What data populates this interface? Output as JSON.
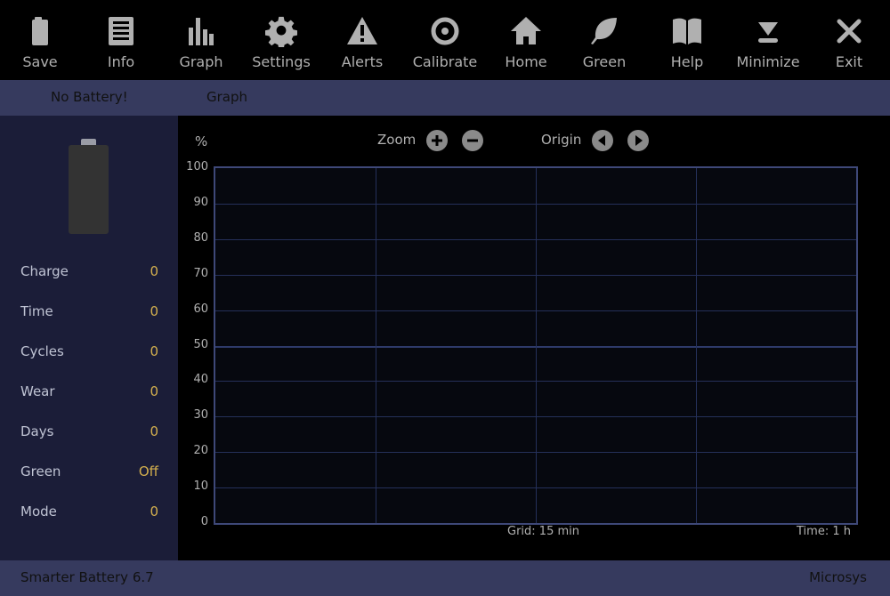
{
  "toolbar": {
    "items": [
      {
        "label": "Save",
        "icon": "battery-icon"
      },
      {
        "label": "Info",
        "icon": "document-icon"
      },
      {
        "label": "Graph",
        "icon": "bar-chart-icon"
      },
      {
        "label": "Settings",
        "icon": "gear-icon"
      },
      {
        "label": "Alerts",
        "icon": "warning-icon"
      },
      {
        "label": "Calibrate",
        "icon": "target-icon"
      },
      {
        "label": "Home",
        "icon": "home-icon"
      },
      {
        "label": "Green",
        "icon": "leaf-icon"
      },
      {
        "label": "Help",
        "icon": "book-icon"
      },
      {
        "label": "Minimize",
        "icon": "minimize-icon"
      },
      {
        "label": "Exit",
        "icon": "close-icon"
      }
    ]
  },
  "tabs": {
    "status": "No Battery!",
    "view": "Graph"
  },
  "battery": {
    "level": 0
  },
  "stats": [
    {
      "label": "Charge",
      "value": "0"
    },
    {
      "label": "Time",
      "value": "0"
    },
    {
      "label": "Cycles",
      "value": "0"
    },
    {
      "label": "Wear",
      "value": "0"
    },
    {
      "label": "Days",
      "value": "0"
    },
    {
      "label": "Green",
      "value": "Off"
    },
    {
      "label": "Mode",
      "value": "0"
    }
  ],
  "graph": {
    "unit_label": "%",
    "zoom_label": "Zoom",
    "origin_label": "Origin",
    "grid_label": "Grid: 15 min",
    "time_label": "Time: 1 h"
  },
  "chart_data": {
    "type": "line",
    "title": "",
    "xlabel": "Time: 1 h",
    "ylabel": "%",
    "ylim": [
      0,
      100
    ],
    "yticks": [
      "100",
      "90",
      "80",
      "70",
      "60",
      "50",
      "40",
      "30",
      "20",
      "10",
      "0"
    ],
    "x_grid_interval": "15 min",
    "x_range": "1 h",
    "series": [],
    "grid": true
  },
  "statusbar": {
    "app": "Smarter Battery 6.7",
    "vendor": "Microsys"
  },
  "colors": {
    "background": "#000000",
    "bar": "#363a5e",
    "sidebar": "#1b1d38",
    "value": "#d4b04e",
    "grid": "#25305a",
    "plot_border": "#3e4878"
  }
}
